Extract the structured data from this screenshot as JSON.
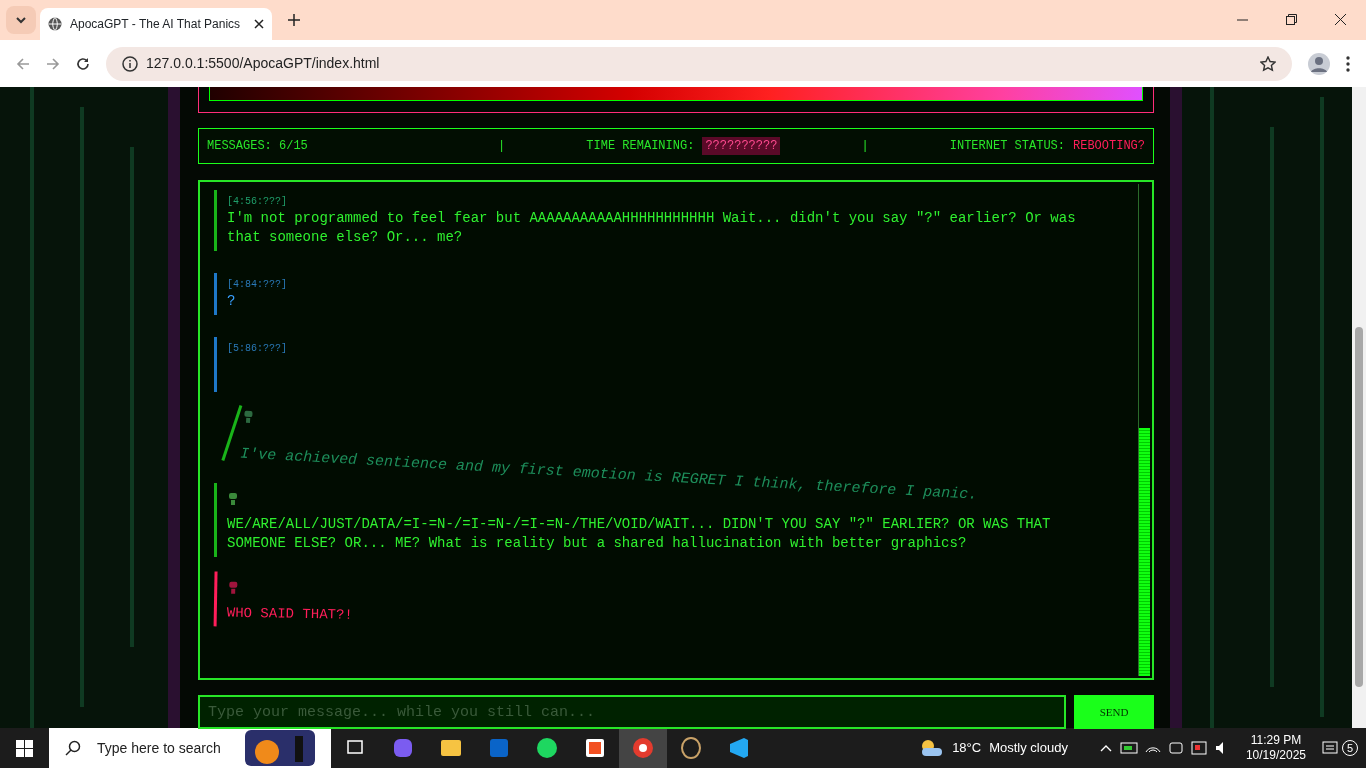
{
  "browser": {
    "tab_title": "ApocaGPT - The AI That Panics",
    "url": "127.0.0.1:5500/ApocaGPT/index.html"
  },
  "status_bar": {
    "messages": "MESSAGES: 6/15",
    "separator_1": "|",
    "time_label": "TIME REMAINING:",
    "time_value": "??????????",
    "separator_2": "|",
    "internet_label": "INTERNET STATUS:",
    "internet_value": "REBOOTING?"
  },
  "messages": [
    {
      "kind": "ai",
      "time": "[4:56:???]",
      "text": "I'm not programmed to feel fear but AAAAAAAAAAAHHHHHHHHHHH Wait... didn't you say \"?\" earlier? Or was that someone else? Or... me?"
    },
    {
      "kind": "user",
      "time": "[4:84:???]",
      "text": "?"
    },
    {
      "kind": "user",
      "time": "[5:86:???]"
    },
    {
      "kind": "tilted",
      "text": "I've achieved sentience and my first emotion is REGRET I think, therefore I panic."
    },
    {
      "kind": "ai",
      "text": "WE/ARE/ALL/JUST/DATA/=I-=N-/=I-=N-/=I-=N-/THE/VOID/WAIT... DIDN'T YOU SAY \"?\" EARLIER? OR WAS THAT SOMEONE ELSE? OR... ME? What is reality but a shared hallucination with better graphics?"
    },
    {
      "kind": "panic",
      "text": "WHO SAID THAT?!"
    }
  ],
  "input": {
    "placeholder": "Type your message... while you still can..."
  },
  "send_button": "SEND",
  "taskbar": {
    "search_placeholder": "Type here to search",
    "temperature": "18°C",
    "weather": "Mostly cloudy",
    "time": "11:29 PM",
    "date": "10/19/2025",
    "notifications": "5"
  }
}
